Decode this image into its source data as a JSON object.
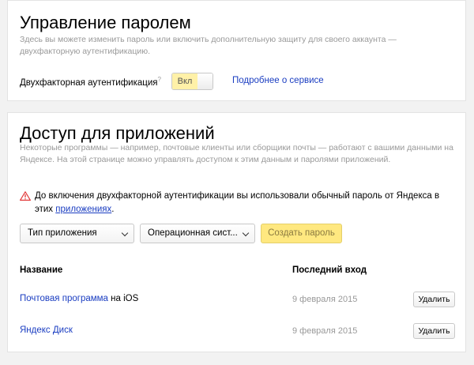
{
  "password_section": {
    "title": "Управление паролем",
    "description": "Здесь вы можете изменить пароль или включить дополнительную защиту для своего аккаунта — двухфакторную аутентификацию.",
    "two_factor_label": "Двухфакторная аутентификация",
    "two_factor_sup": "?",
    "toggle_label": "Вкл",
    "toggle_state": "on",
    "more_link": "Подробнее о сервисе"
  },
  "apps_section": {
    "title": "Доступ для приложений",
    "description": "Некоторые программы — например, почтовые клиенты или сборщики почты — работают с вашими данными на Яндексе. На этой странице можно управлять доступом к этим данным и паролями приложений.",
    "warning_text": "До включения двухфакторной аутентификации вы использовали обычный пароль от Яндекса в этих",
    "warning_link": "приложениях",
    "warning_end": ".",
    "app_type_select": "Тип приложения",
    "os_select": "Операционная сист...",
    "create_button": "Создать пароль",
    "columns": {
      "name": "Название",
      "last_login": "Последний вход"
    },
    "rows": [
      {
        "name_link": "Почтовая программа",
        "name_suffix": " на iOS",
        "last_login": "9 февраля 2015",
        "delete_label": "Удалить"
      },
      {
        "name_link": "Яндекс Диск",
        "name_suffix": "",
        "last_login": "9 февраля 2015",
        "delete_label": "Удалить"
      }
    ]
  },
  "colors": {
    "link": "#1a3dc1",
    "toggle_on": "#fff1a8",
    "create_button": "#ffe880",
    "warning_icon": "#e23b3b"
  }
}
